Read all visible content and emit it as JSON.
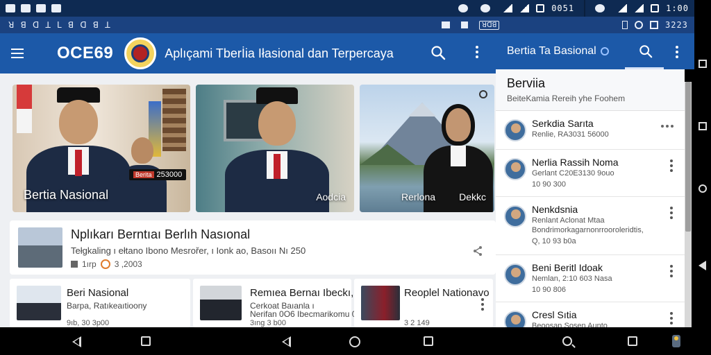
{
  "status_bar": {
    "time_left": "0051",
    "time_right": "1:00"
  },
  "strip": {
    "left_text": "ꓤ ꓭ ꓷ ꓕ ꓡ ꓭ ꓷ ꓭ ꓕ",
    "mid_chip": "ꓤꓷꓭ",
    "right_time": "3223"
  },
  "appbar": {
    "brand": "OCE69",
    "title": "Aplıçami Tberİia Iłasional dan Terpercaya"
  },
  "right_appbar": {
    "title": "Bertia Ta Basional"
  },
  "cards": [
    {
      "caption": "Bertia Nasional",
      "badge_red": "Berita",
      "badge": "253000"
    },
    {
      "caption": "Aodcia"
    },
    {
      "caption": "Rerlona",
      "caption2": "Dekkc"
    }
  ],
  "featured": {
    "title": "Nplıkarı Berntıaı Berlıh Nasıonal",
    "subtitle": "Tełgkaling ı ełtano Ibono Mesrořer, ı Ionk ao, Basoıı Nı 250",
    "meta1": "1ırp",
    "meta2": "3 ,2003"
  },
  "minis": [
    {
      "title": "Beri Nasional",
      "subtitle": "Barpa, Ratıkeaıtioony",
      "meta": "9ıb, 30 3p00"
    },
    {
      "title": "Remıea Bernaı Ibeckı,",
      "subtitle": "Cerkoat Baıanla ı",
      "subtitle2": "Nerifan 0O6 Ibecmarikomu 0",
      "meta": "3ıng 3 b00"
    },
    {
      "title": "Reoplel Nationavo",
      "meta": "3 2 149"
    }
  ],
  "panel": {
    "header_title": "Berviia",
    "header_sub": "BeiteKamia Rereih yhe Foohem",
    "items": [
      {
        "title": "Serkdia Sarıta",
        "subtitle": "Renlie, RA3031 56000"
      },
      {
        "title": "Nerlia Rassih Noma",
        "subtitle": "Gerlant C20E3130 9ouo",
        "meta": "10 90 300"
      },
      {
        "title": "Nenkdsnia",
        "subtitle": "Renlant Aclonat Mtaa",
        "subtitle2": "Bondrimorkagarnonrrooroleridtis,",
        "meta": "Q, 10 93 b0a"
      },
      {
        "title": "Beni Beritl Idoak",
        "subtitle": "Nemlan, 2:10 603 Nasa",
        "meta": "10 90 806"
      },
      {
        "title": "Cresl Sıtia",
        "subtitle": "Beoosan Sosen Aunto"
      }
    ]
  },
  "colors": {
    "appbar": "#1c59a8",
    "statusbar": "#0e2a52",
    "background": "#eef0f3",
    "accent_red": "#c0202a"
  }
}
